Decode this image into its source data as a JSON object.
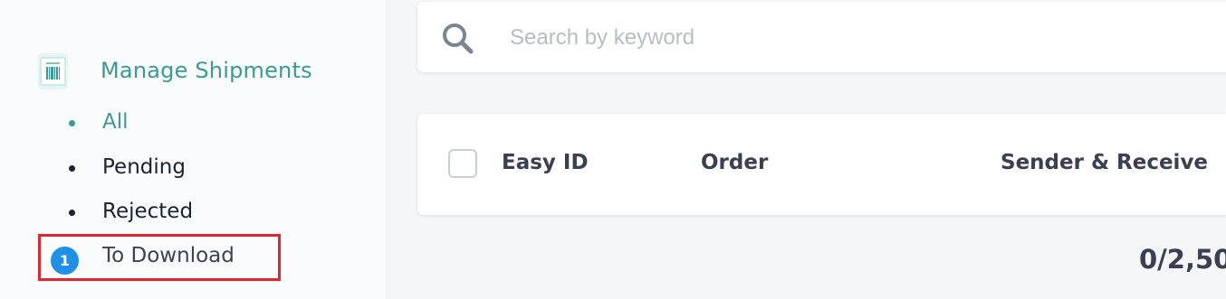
{
  "sidebar": {
    "section": {
      "icon": "barcode-icon",
      "label": "Manage Shipments"
    },
    "items": [
      {
        "label": "All",
        "active": true
      },
      {
        "label": "Pending",
        "active": false
      },
      {
        "label": "Rejected",
        "active": false
      }
    ],
    "download": {
      "badge": "1",
      "label": "To Download"
    }
  },
  "search": {
    "placeholder": "Search by keyword",
    "icon": "search-icon"
  },
  "table": {
    "headers": [
      "Easy ID",
      "Order",
      "Sender & Receive"
    ]
  },
  "pager": {
    "text": "0/2,50"
  },
  "colors": {
    "accent": "#3a9a94",
    "badge": "#1e90e6",
    "highlight": "#e0262e"
  }
}
